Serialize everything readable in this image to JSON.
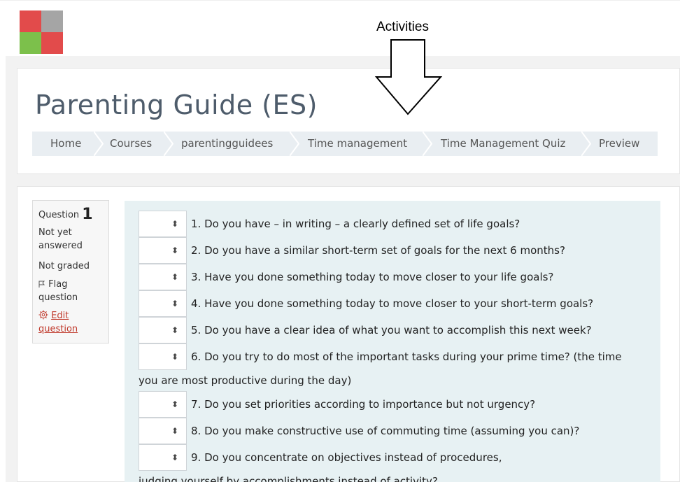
{
  "annotation": {
    "label": "Activities"
  },
  "course": {
    "title": "Parenting Guide (ES)"
  },
  "breadcrumb": [
    "Home",
    "Courses",
    "parentingguidees",
    "Time management",
    "Time Management Quiz",
    "Preview"
  ],
  "question_info": {
    "label": "Question",
    "number": "1",
    "status": "Not yet answered",
    "grading": "Not graded",
    "flag": "Flag question",
    "edit": "Edit question"
  },
  "questions": [
    "1. Do you have – in writing – a clearly defined set of life goals?",
    "2. Do you have a similar short-term set of goals for the next 6 months?",
    "3. Have you done something today to move closer to your life goals?",
    "4. Have you done something today to move closer to your short-term goals?",
    "5. Do you have a clear idea of what you want to accomplish this next week?",
    "6. Do you try to do most of the important tasks during your prime time?   (the time",
    "you are most productive during the day)",
    "7. Do you set priorities according to importance but not urgency?",
    "8. Do you make constructive use of commuting time (assuming you can)?",
    "9. Do you concentrate on objectives instead of procedures,",
    "judging yourself by accomplishments instead of activity?"
  ],
  "colors": {
    "accent": "#c0392b",
    "content_bg": "#e7f1f3",
    "breadcrumb_bg": "#e9eef2"
  }
}
